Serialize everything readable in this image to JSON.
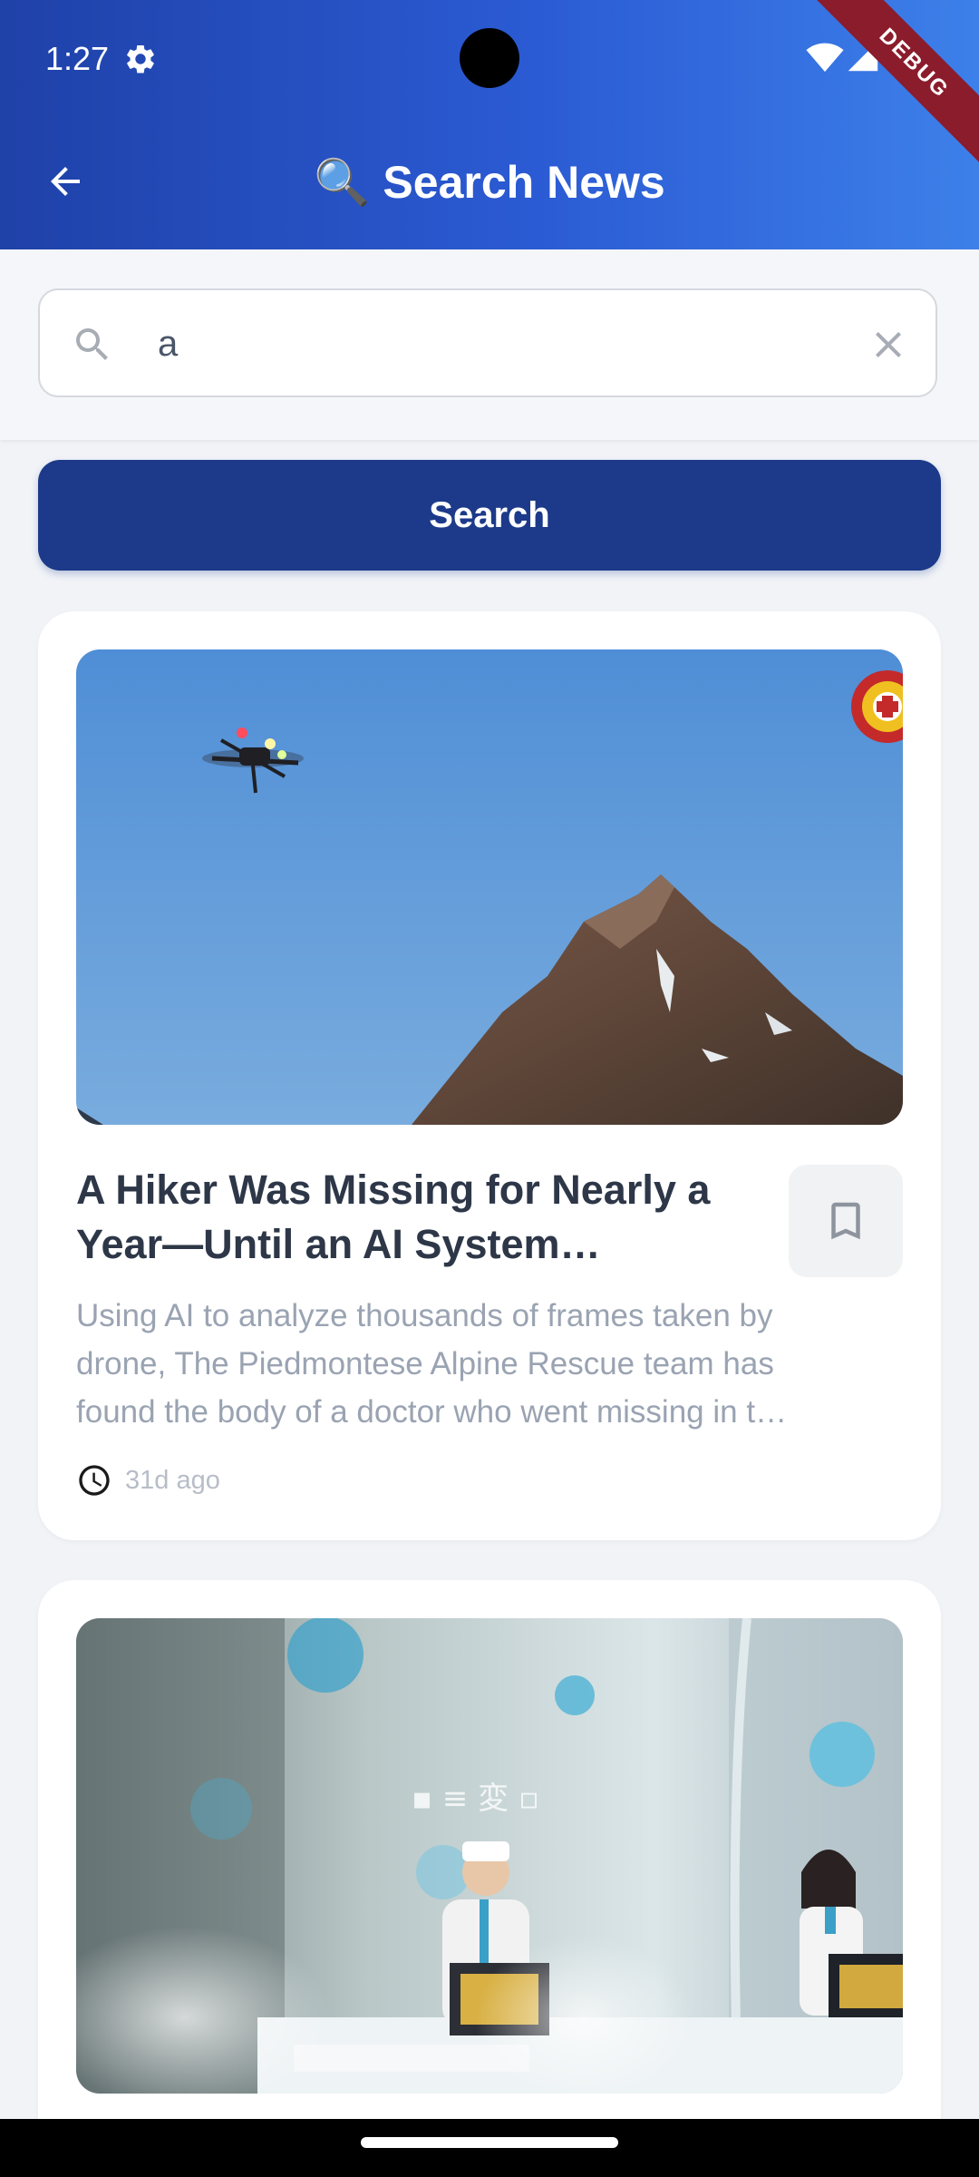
{
  "status_bar": {
    "time": "1:27",
    "settings_icon": "gear-icon",
    "wifi_icon": "wifi-icon",
    "signal_icon": "cell-signal-icon"
  },
  "debug_banner": {
    "label": "DEBUG"
  },
  "app_bar": {
    "back_icon": "arrow-left-icon",
    "title": "🔍 Search News"
  },
  "search": {
    "value": "a",
    "placeholder": "",
    "search_icon": "search-icon",
    "clear_icon": "close-icon",
    "button_label": "Search"
  },
  "results": [
    {
      "image": "drone-over-mountain-photo",
      "title": "A Hiker Was Missing for Nearly a Year—Until an AI System Recognized His Helmet",
      "description": "Using AI to analyze thousands of frames taken by drone, The Piedmontese Alpine Rescue team has found the body of a doctor who went missing in the Alps.",
      "time_ago": "31d ago",
      "bookmark_icon": "bookmark-outline-icon",
      "clock_icon": "clock-icon"
    },
    {
      "image": "robot-receptionists-photo"
    }
  ],
  "colors": {
    "header_start": "#1f41a8",
    "header_end": "#3d80ea",
    "button": "#1d3a8a",
    "title_text": "#2d3748",
    "description_text": "#9aa3b2",
    "meta_text": "#b7bdc8",
    "debug_ribbon": "#8b1c2c"
  }
}
